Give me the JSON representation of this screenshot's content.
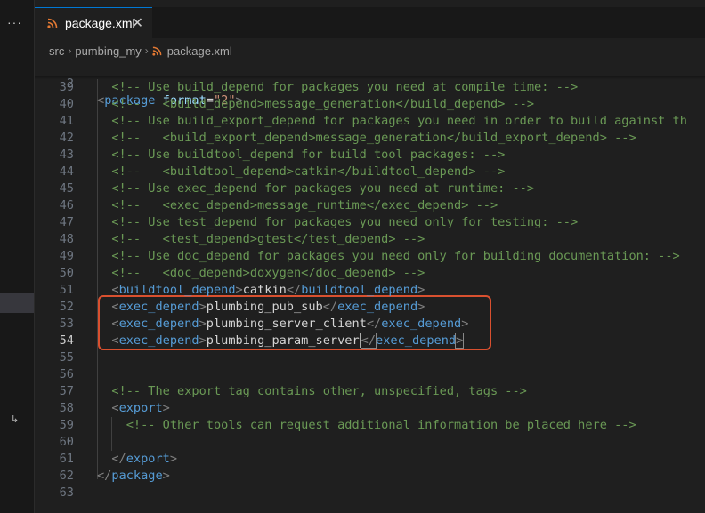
{
  "activity": {
    "more_glyph": "···",
    "return_glyph": "↳"
  },
  "tab": {
    "label": "package.xml",
    "close_glyph": "✕"
  },
  "breadcrumb": {
    "items": [
      "src",
      "pumbing_my",
      "package.xml"
    ]
  },
  "colors": {
    "accent": "#0078d4",
    "highlight_border": "#d9502f",
    "comment": "#6a9955",
    "tag": "#569cd6",
    "attr": "#9cdcfe",
    "string": "#ce9178"
  },
  "sticky": {
    "number": "2",
    "tokens": [
      {
        "t": "<",
        "c": "c-bracket"
      },
      {
        "t": "package",
        "c": "c-tag"
      },
      {
        "t": " ",
        "c": "c-text"
      },
      {
        "t": "format",
        "c": "c-attr"
      },
      {
        "t": "=",
        "c": "c-text"
      },
      {
        "t": "\"2\"",
        "c": "c-str"
      },
      {
        "t": ">",
        "c": "c-bracket"
      }
    ]
  },
  "lines": [
    {
      "n": "39",
      "tokens": [
        {
          "t": "  <!-- Use build_depend for packages you need at compile time: -->",
          "c": "c-comment"
        }
      ]
    },
    {
      "n": "40",
      "tokens": [
        {
          "t": "  <!--   <build_depend>message_generation</build_depend> -->",
          "c": "c-comment"
        }
      ]
    },
    {
      "n": "41",
      "tokens": [
        {
          "t": "  <!-- Use build_export_depend for packages you need in order to build against th",
          "c": "c-comment"
        }
      ]
    },
    {
      "n": "42",
      "tokens": [
        {
          "t": "  <!--   <build_export_depend>message_generation</build_export_depend> -->",
          "c": "c-comment"
        }
      ]
    },
    {
      "n": "43",
      "tokens": [
        {
          "t": "  <!-- Use buildtool_depend for build tool packages: -->",
          "c": "c-comment"
        }
      ]
    },
    {
      "n": "44",
      "tokens": [
        {
          "t": "  <!--   <buildtool_depend>catkin</buildtool_depend> -->",
          "c": "c-comment"
        }
      ]
    },
    {
      "n": "45",
      "tokens": [
        {
          "t": "  <!-- Use exec_depend for packages you need at runtime: -->",
          "c": "c-comment"
        }
      ]
    },
    {
      "n": "46",
      "tokens": [
        {
          "t": "  <!--   <exec_depend>message_runtime</exec_depend> -->",
          "c": "c-comment"
        }
      ]
    },
    {
      "n": "47",
      "tokens": [
        {
          "t": "  <!-- Use test_depend for packages you need only for testing: -->",
          "c": "c-comment"
        }
      ]
    },
    {
      "n": "48",
      "tokens": [
        {
          "t": "  <!--   <test_depend>gtest</test_depend> -->",
          "c": "c-comment"
        }
      ]
    },
    {
      "n": "49",
      "tokens": [
        {
          "t": "  <!-- Use doc_depend for packages you need only for building documentation: -->",
          "c": "c-comment"
        }
      ]
    },
    {
      "n": "50",
      "tokens": [
        {
          "t": "  <!--   <doc_depend>doxygen</doc_depend> -->",
          "c": "c-comment"
        }
      ]
    },
    {
      "n": "51",
      "tokens": [
        {
          "t": "  ",
          "c": "c-text"
        },
        {
          "t": "<",
          "c": "c-bracket"
        },
        {
          "t": "buildtool_depend",
          "c": "c-tag"
        },
        {
          "t": ">",
          "c": "c-bracket"
        },
        {
          "t": "catkin",
          "c": "c-text"
        },
        {
          "t": "</",
          "c": "c-bracket"
        },
        {
          "t": "buildtool_depend",
          "c": "c-tag"
        },
        {
          "t": ">",
          "c": "c-bracket"
        }
      ]
    },
    {
      "n": "52",
      "tokens": [
        {
          "t": "  ",
          "c": "c-text"
        },
        {
          "t": "<",
          "c": "c-bracket"
        },
        {
          "t": "exec_depend",
          "c": "c-tag"
        },
        {
          "t": ">",
          "c": "c-bracket"
        },
        {
          "t": "plumbing_pub_sub",
          "c": "c-text"
        },
        {
          "t": "</",
          "c": "c-bracket"
        },
        {
          "t": "exec_depend",
          "c": "c-tag"
        },
        {
          "t": ">",
          "c": "c-bracket"
        }
      ]
    },
    {
      "n": "53",
      "tokens": [
        {
          "t": "  ",
          "c": "c-text"
        },
        {
          "t": "<",
          "c": "c-bracket"
        },
        {
          "t": "exec_depend",
          "c": "c-tag"
        },
        {
          "t": ">",
          "c": "c-bracket"
        },
        {
          "t": "plumbing_server_client",
          "c": "c-text"
        },
        {
          "t": "</",
          "c": "c-bracket"
        },
        {
          "t": "exec_depend",
          "c": "c-tag"
        },
        {
          "t": ">",
          "c": "c-bracket"
        }
      ]
    },
    {
      "n": "54",
      "tokens": [
        {
          "t": "  ",
          "c": "c-text"
        },
        {
          "t": "<",
          "c": "c-bracket"
        },
        {
          "t": "exec_depend",
          "c": "c-tag"
        },
        {
          "t": ">",
          "c": "c-bracket"
        },
        {
          "t": "plumbing_param_server",
          "c": "c-text"
        },
        {
          "t": "</",
          "c": "c-bracket bracket-box"
        },
        {
          "t": "exec_depend",
          "c": "c-tag"
        },
        {
          "t": ">",
          "c": "c-bracket bracket-box"
        }
      ]
    },
    {
      "n": "55",
      "tokens": []
    },
    {
      "n": "56",
      "tokens": []
    },
    {
      "n": "57",
      "tokens": [
        {
          "t": "  <!-- The export tag contains other, unspecified, tags -->",
          "c": "c-comment"
        }
      ]
    },
    {
      "n": "58",
      "tokens": [
        {
          "t": "  ",
          "c": "c-text"
        },
        {
          "t": "<",
          "c": "c-bracket"
        },
        {
          "t": "export",
          "c": "c-tag"
        },
        {
          "t": ">",
          "c": "c-bracket"
        }
      ]
    },
    {
      "n": "59",
      "tokens": [
        {
          "t": "    <!-- Other tools can request additional information be placed here -->",
          "c": "c-comment"
        }
      ]
    },
    {
      "n": "60",
      "tokens": []
    },
    {
      "n": "61",
      "tokens": [
        {
          "t": "  ",
          "c": "c-text"
        },
        {
          "t": "</",
          "c": "c-bracket"
        },
        {
          "t": "export",
          "c": "c-tag"
        },
        {
          "t": ">",
          "c": "c-bracket"
        }
      ]
    },
    {
      "n": "62",
      "tokens": [
        {
          "t": "</",
          "c": "c-bracket"
        },
        {
          "t": "package",
          "c": "c-tag"
        },
        {
          "t": ">",
          "c": "c-bracket"
        }
      ]
    },
    {
      "n": "63",
      "tokens": []
    }
  ]
}
